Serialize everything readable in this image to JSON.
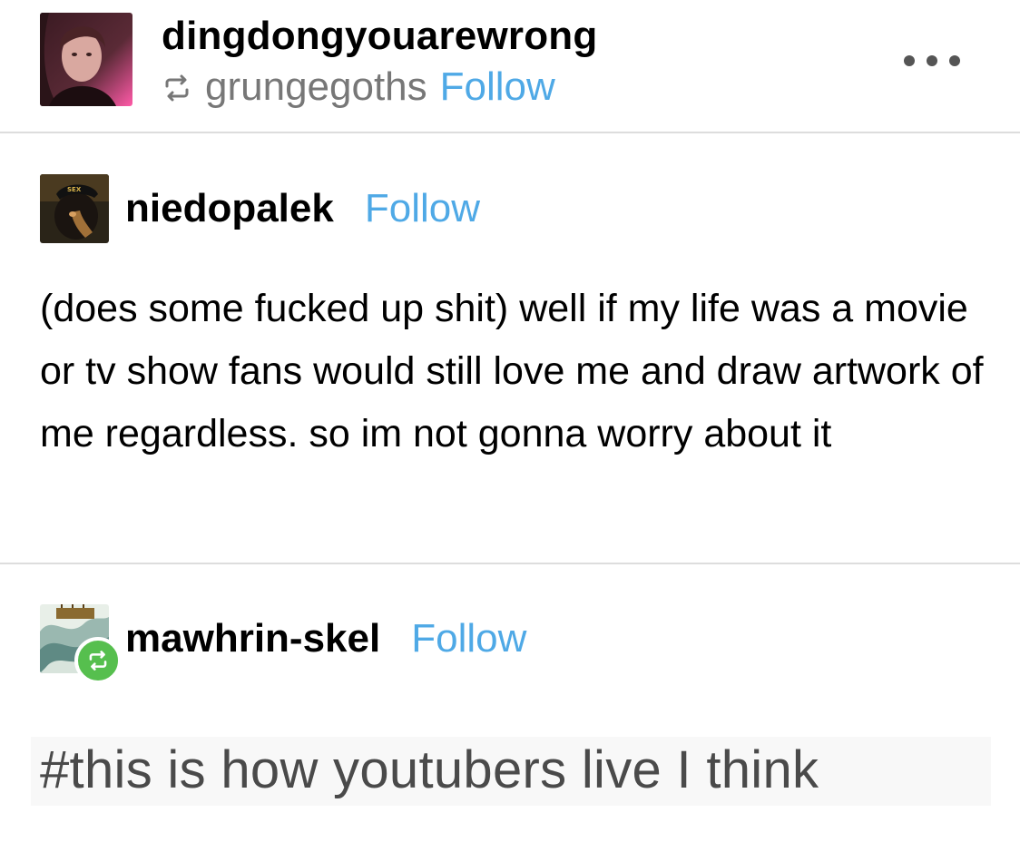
{
  "header": {
    "username": "dingdongyouarewrong",
    "reblogged_from": "grungegoths",
    "follow_label": "Follow",
    "reblog_icon": "reblog-icon",
    "more_icon": "more-dots-icon"
  },
  "posts": [
    {
      "author": "niedopalek",
      "follow_label": "Follow",
      "body": "(does some fucked up shit) well if my life was a movie or tv show fans would still love me and draw artwork of me regardless. so im not gonna worry about it"
    },
    {
      "author": "mawhrin-skel",
      "follow_label": "Follow",
      "badge_icon": "reblog-badge-icon",
      "tag": "#this is how youtubers live I think"
    }
  ],
  "colors": {
    "follow": "#4fa9e6",
    "reblog_badge": "#56bf4e",
    "secondary_text": "#777777",
    "divider": "#dddddd"
  }
}
